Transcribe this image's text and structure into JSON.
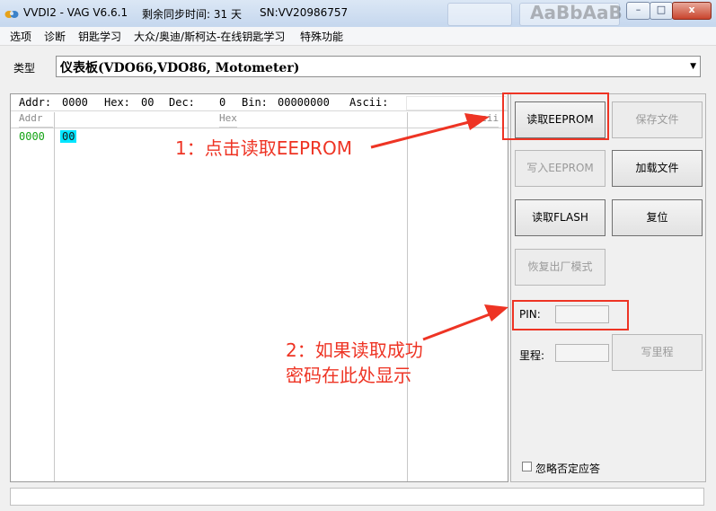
{
  "titlebar": {
    "title": "VVDI2 - VAG V6.6.1",
    "remaining": "剩余同步时间: 31 天",
    "sn": "SN:VV20986757",
    "background_ghost_text": "AaBbAaB",
    "minimize": "–",
    "maximize": "□",
    "close": "x"
  },
  "menu": [
    "选项",
    "诊断",
    "钥匙学习",
    "大众/奥迪/斯柯达-在线钥匙学习",
    "特殊功能"
  ],
  "type_selector": {
    "label": "类型",
    "value": "仪表板(VDO66,VDO86, Motometer)"
  },
  "hex_status": {
    "addr_label": "Addr:",
    "addr_value": "0000",
    "hex_label": "Hex:",
    "hex_value": "00",
    "dec_label": "Dec:",
    "dec_value": "0",
    "bin_label": "Bin:",
    "bin_value": "00000000",
    "ascii_label": "Ascii:"
  },
  "hex_columns": {
    "addr": "Addr",
    "hex": "Hex",
    "ascii": "Ascii"
  },
  "hex_rows": [
    {
      "addr": "0000",
      "hex": "00"
    }
  ],
  "buttons": {
    "read_eeprom": "读取EEPROM",
    "save_file": "保存文件",
    "write_eeprom": "写入EEPROM",
    "load_file": "加载文件",
    "read_flash": "读取FLASH",
    "reset": "复位",
    "factory_restore": "恢复出厂模式",
    "write_mileage": "写里程"
  },
  "fields": {
    "pin_label": "PIN:",
    "pin_value": "",
    "mileage_label": "里程:",
    "mileage_value": ""
  },
  "ignore_negative": {
    "label": "忽略否定应答",
    "checked": false
  },
  "annotations": {
    "step1": "1：点击读取EEPROM",
    "step2_line1": "2：如果读取成功",
    "step2_line2": "密码在此处显示"
  },
  "colors": {
    "annotation_red": "#ee3424",
    "hex_highlight": "#00e5ff",
    "address_green": "#13a313"
  }
}
